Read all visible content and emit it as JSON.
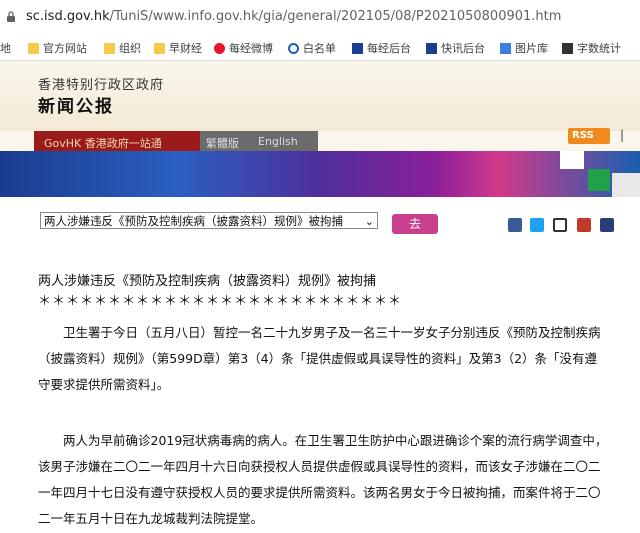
{
  "browser": {
    "url_host": "sc.isd.gov.hk",
    "url_path": "/TuniS/www.info.gov.hk/gia/general/202105/08/P2021050800901.htm"
  },
  "bookmarks": [
    {
      "label": "地",
      "icon": "page-icon"
    },
    {
      "label": "官方网站",
      "icon": "folder-icon"
    },
    {
      "label": "组织",
      "icon": "folder-icon"
    },
    {
      "label": "早财经",
      "icon": "folder-icon"
    },
    {
      "label": "每经微博",
      "icon": "weibo-icon"
    },
    {
      "label": "白名单",
      "icon": "link-icon"
    },
    {
      "label": "每经后台",
      "icon": "n-icon"
    },
    {
      "label": "快讯后台",
      "icon": "n-icon"
    },
    {
      "label": "图片库",
      "icon": "photo-icon"
    },
    {
      "label": "字数统计",
      "icon": "counter-icon"
    }
  ],
  "header": {
    "gov_name": "香港特别行政区政府",
    "site_name": "新闻公报",
    "govhk_link": "GovHK 香港政府一站通",
    "lang_trad": "繁體版",
    "lang_en": "English",
    "rss": "RSS"
  },
  "toolbar": {
    "select_value": "两人涉嫌违反《预防及控制疾病（披露资料）规例》被拘捕",
    "go_label": "去"
  },
  "article": {
    "title": "两人涉嫌违反《预防及控制疾病（披露资料）规例》被拘捕",
    "stars": "＊＊＊＊＊＊＊＊＊＊＊＊＊＊＊＊＊＊＊＊＊＊＊＊＊＊",
    "p1_lines": [
      "　　卫生署于今日（五月八日）暂控一名二十九岁男子及一名三十一岁女子分别违反《预防及控制疾病",
      "（披露资料）规例》（第599D章）第3（4）条「提供虚假或具误导性的资料」及第3（2）条「没有遵",
      "守要求提供所需资料」。"
    ],
    "p2_lines": [
      "　　两人为早前确诊2019冠状病毒病的病人。在卫生署卫生防护中心跟进确诊个案的流行病学调查中，",
      "该男子涉嫌在二〇二一年四月十六日向获授权人员提供虚假或具误导性的资料，而该女子涉嫌在二〇二",
      "一年四月十七日没有遵守获授权人员的要求提供所需资料。该两名男女于今日被拘捕，而案件将于二〇",
      "二一年五月十日在九龙城裁判法院提堂。"
    ]
  },
  "colors": {
    "go_button": "#c8408c",
    "govhk_bar": "#9b1b1b",
    "rss": "#f08a1c"
  }
}
